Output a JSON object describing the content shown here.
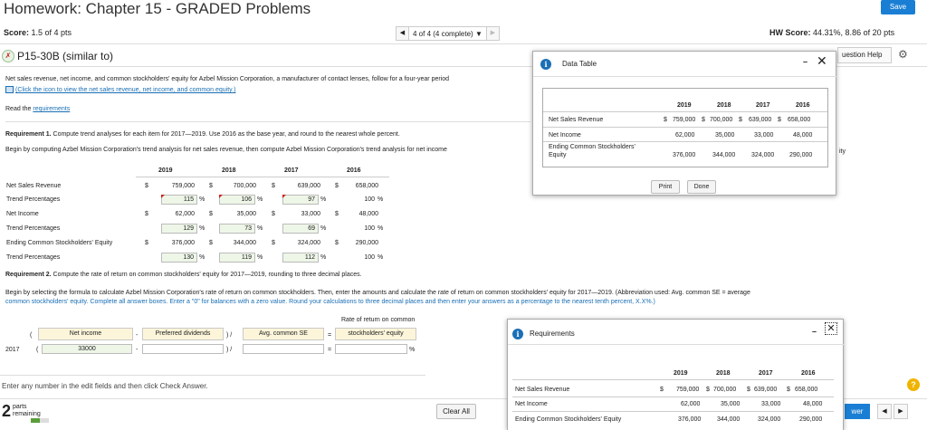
{
  "header": {
    "title": "Homework: Chapter 15 - GRADED Problems",
    "save_label": "Save",
    "score_label": "Score:",
    "score_value": "1.5 of 4 pts",
    "nav_status": "4 of 4 (4 complete)",
    "hw_score_label": "HW Score:",
    "hw_score_value": "44.31%, 8.86 of 20 pts"
  },
  "question": {
    "id": "P15-30B (similar to)",
    "help_label": "uestion Help",
    "intro": "Net sales revenue, net income, and common stockholders' equity for Azbel Mission Corporation, a manufacturer of contact lenses, follow for a four-year period",
    "icon_link": "(Click the icon to view the net sales revenue, net income, and common equity.)",
    "read_prefix": "Read the",
    "read_link": "requirements",
    "req1_label": "Requirement 1.",
    "req1_text": "Compute trend analyses for each item for 2017—2019. Use 2016 as the base year, and round to the nearest whole percent.",
    "req1_begin": "Begin by computing Azbel Mission Corporation's trend analysis for net sales revenue, then compute Azbel Mission Corporation's trend analysis for net income",
    "req2_label": "Requirement 2.",
    "req2_text": "Compute the rate of return on common stockholders' equity for 2017—2019, rounding to three decimal places.",
    "req2_begin": "Begin by selecting the formula to calculate Azbel Mission Corporation's rate of return on common stockholders. Then, enter the amounts and calculate the rate of return on common stockholders' equity for 2017—2019. (Abbreviation used: Avg. common SE = average",
    "req2_begin2": "common stockholders' equity. Complete all answer boxes. Enter a \"0\" for balances with a zero value. Round your calculations to three decimal places and then enter your answers as a percentage to the nearest tenth percent, X.X%.)",
    "edit_hint": "Enter any number in the edit fields and then click Check Answer.",
    "clear_all": "Clear All",
    "parts_count": "2",
    "parts_label": "parts",
    "remaining_label": "remaining",
    "parts_progress": 0.5,
    "answer_label": "wer",
    "help_symbol": "?"
  },
  "trend": {
    "years": [
      "2019",
      "2018",
      "2017",
      "2016"
    ],
    "rows": [
      {
        "label": "Net Sales Revenue",
        "cur": "$",
        "values": [
          "759,000",
          "700,000",
          "639,000",
          "658,000"
        ]
      },
      {
        "label": "Trend Percentages",
        "pct": [
          "115",
          "106",
          "97",
          "100"
        ]
      },
      {
        "label": "Net Income",
        "cur": "$",
        "values": [
          "62,000",
          "35,000",
          "33,000",
          "48,000"
        ]
      },
      {
        "label": "Trend Percentages",
        "pct": [
          "129",
          "73",
          "69",
          "100"
        ]
      },
      {
        "label": "Ending Common Stockholders' Equity",
        "cur": "$",
        "values": [
          "376,000",
          "344,000",
          "324,000",
          "290,000"
        ]
      },
      {
        "label": "Trend Percentages",
        "pct": [
          "130",
          "119",
          "112",
          "100"
        ]
      }
    ],
    "pct_sign": "%"
  },
  "ror": {
    "header_net_income": "Net income",
    "header_pref": "Preferred dividends",
    "header_avg": "Avg. common SE",
    "header_result_1": "Rate of return on common",
    "header_result_2": "stockholders' equity",
    "open_paren": "(",
    "minus": "-",
    "close_div": ") /",
    "equals": "=",
    "year": "2017",
    "net_income_value": "33000",
    "pct_sign": "%"
  },
  "data_table_popup": {
    "title": "Data Table",
    "years": [
      "2019",
      "2018",
      "2017",
      "2016"
    ],
    "rows": [
      {
        "label": "Net Sales Revenue",
        "cur": "$",
        "values": [
          "759,000",
          "700,000",
          "639,000",
          "658,000"
        ]
      },
      {
        "label": "Net Income",
        "values": [
          "62,000",
          "35,000",
          "33,000",
          "48,000"
        ]
      },
      {
        "label_1": "Ending Common Stockholders'",
        "label_2": "Equity",
        "values": [
          "376,000",
          "344,000",
          "324,000",
          "290,000"
        ]
      }
    ],
    "print_label": "Print",
    "done_label": "Done",
    "obscured_right": "ity"
  },
  "requirements_popup": {
    "title": "Requirements",
    "years": [
      "2019",
      "2018",
      "2017",
      "2016"
    ],
    "rows": [
      {
        "label": "Net Sales Revenue",
        "cur": "$",
        "values": [
          "759,000",
          "700,000",
          "639,000",
          "658,000"
        ]
      },
      {
        "label": "Net Income",
        "values": [
          "62,000",
          "35,000",
          "33,000",
          "48,000"
        ]
      },
      {
        "label": "Ending Common Stockholders' Equity",
        "values": [
          "376,000",
          "344,000",
          "324,000",
          "290,000"
        ]
      }
    ]
  },
  "colors": {
    "accent": "#1a7fd4",
    "input_bg": "#eef6e8",
    "header_box_bg": "#fcf5d9",
    "error_marker": "#cc2222"
  }
}
